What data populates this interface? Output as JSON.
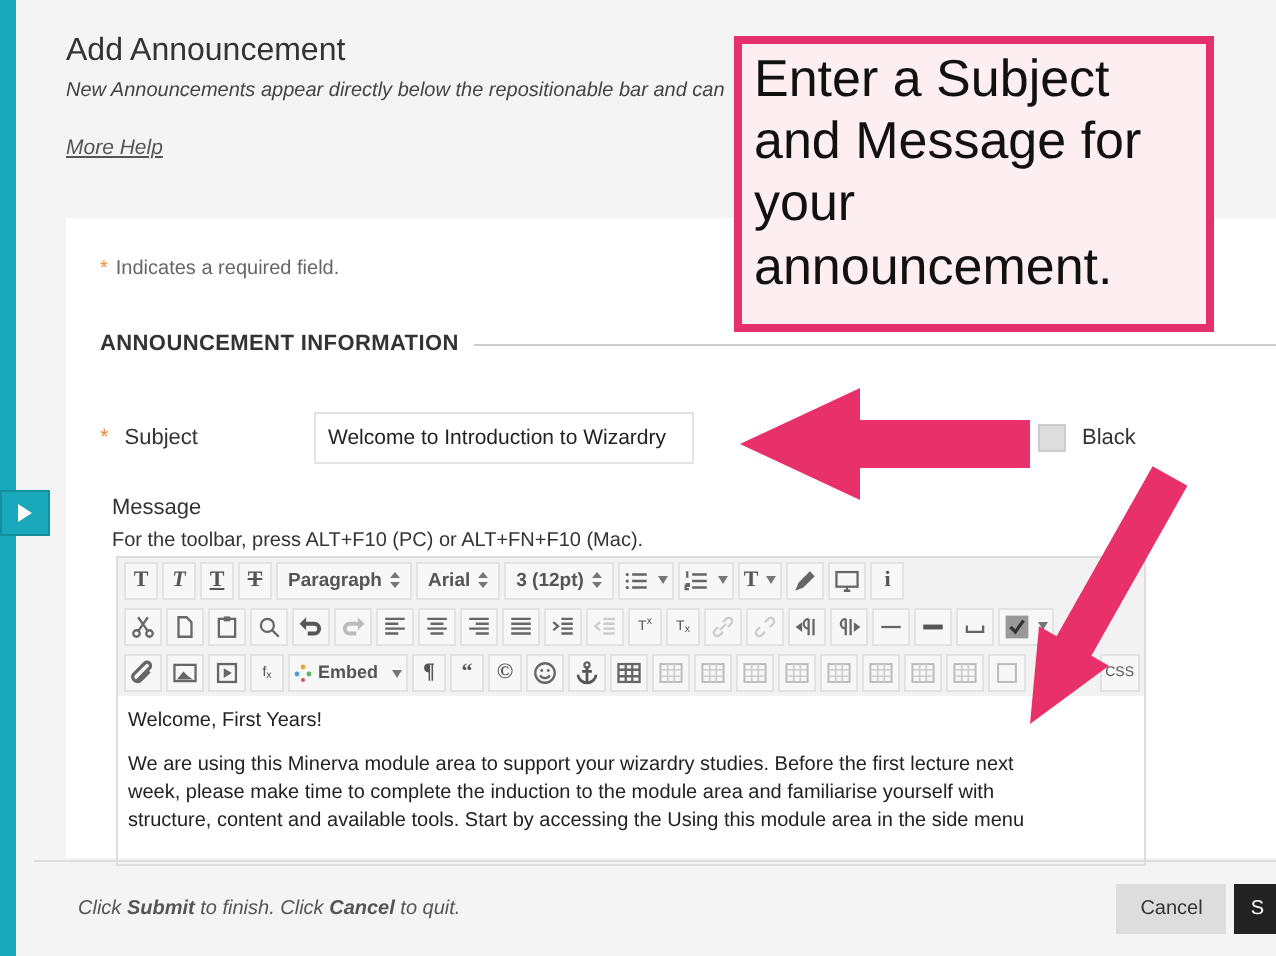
{
  "page": {
    "title": "Add Announcement",
    "subtitle": "New Announcements appear directly below the repositionable bar and can",
    "help_link": "More Help"
  },
  "form": {
    "required_note": "Indicates a required field.",
    "required_mark": "*",
    "section_title": "ANNOUNCEMENT INFORMATION",
    "subject": {
      "label": "Subject",
      "required": true,
      "value": "Welcome to Introduction to Wizardry"
    },
    "color_option": {
      "checked": false,
      "label": "Black"
    },
    "message": {
      "label": "Message",
      "hint": "For the toolbar, press ALT+F10 (PC) or ALT+FN+F10 (Mac)."
    },
    "toolbar": [
      [
        {
          "kind": "glyph",
          "text": "T"
        },
        {
          "kind": "glyph",
          "text": "T"
        },
        {
          "kind": "glyph",
          "text": "T"
        },
        {
          "kind": "glyph",
          "text": "T"
        },
        {
          "kind": "select",
          "text": "Paragraph"
        },
        {
          "kind": "select",
          "text": "Arial"
        },
        {
          "kind": "select",
          "text": "3 (12pt)"
        },
        {
          "kind": "icon",
          "caret": true
        },
        {
          "kind": "icon",
          "caret": true
        },
        {
          "kind": "glyph",
          "text": "T",
          "caret": true
        },
        {
          "kind": "icon"
        },
        {
          "kind": "icon"
        },
        {
          "kind": "glyph",
          "text": "i"
        }
      ],
      [
        {
          "kind": "icon"
        },
        {
          "kind": "icon"
        },
        {
          "kind": "icon"
        },
        {
          "kind": "icon"
        },
        {
          "kind": "icon"
        },
        {
          "kind": "icon"
        },
        {
          "kind": "icon"
        },
        {
          "kind": "icon"
        },
        {
          "kind": "icon"
        },
        {
          "kind": "icon"
        },
        {
          "kind": "icon"
        },
        {
          "kind": "icon"
        },
        {
          "kind": "glyph",
          "text": "T$^{x}$"
        },
        {
          "kind": "glyph",
          "text": "T$_{x}$"
        },
        {
          "kind": "icon"
        },
        {
          "kind": "icon"
        },
        {
          "kind": "icon"
        },
        {
          "kind": "icon"
        },
        {
          "kind": "icon"
        },
        {
          "kind": "icon"
        },
        {
          "kind": "icon"
        },
        {
          "kind": "icon",
          "caret": true
        }
      ],
      [
        {
          "kind": "icon"
        },
        {
          "kind": "icon"
        },
        {
          "kind": "icon"
        },
        {
          "kind": "glyph",
          "text": "f$_{x}$"
        },
        {
          "kind": "menu",
          "text": "Embed",
          "caret": true
        },
        {
          "kind": "glyph",
          "text": "¶"
        },
        {
          "kind": "glyph",
          "text": "“"
        },
        {
          "kind": "glyph",
          "text": "©"
        },
        {
          "kind": "icon"
        },
        {
          "kind": "icon"
        },
        {
          "kind": "icon"
        },
        {
          "kind": "icon"
        },
        {
          "kind": "icon"
        },
        {
          "kind": "icon"
        },
        {
          "kind": "icon"
        },
        {
          "kind": "icon"
        },
        {
          "kind": "icon"
        },
        {
          "kind": "icon"
        },
        {
          "kind": "icon"
        },
        {
          "kind": "icon"
        },
        {
          "kind": "glyph",
          "text": "CSS"
        }
      ]
    ],
    "body": [
      "Welcome, First Years!",
      "We are using this Minerva module area to support your wizardry studies. Before the first lecture next week, please make time to complete the induction to the module area and familiarise yourself with structure, content and available tools. Start by accessing the Using this module area in the side menu"
    ]
  },
  "footer": {
    "instruction": "Click **Submit** to finish. Click **Cancel** to quit.",
    "buttons": [
      {
        "kind": "secondary",
        "label": "Cancel"
      },
      {
        "kind": "primary",
        "label": "S"
      }
    ]
  },
  "callout": {
    "text": "Enter a Subject and Message for your announcement."
  }
}
